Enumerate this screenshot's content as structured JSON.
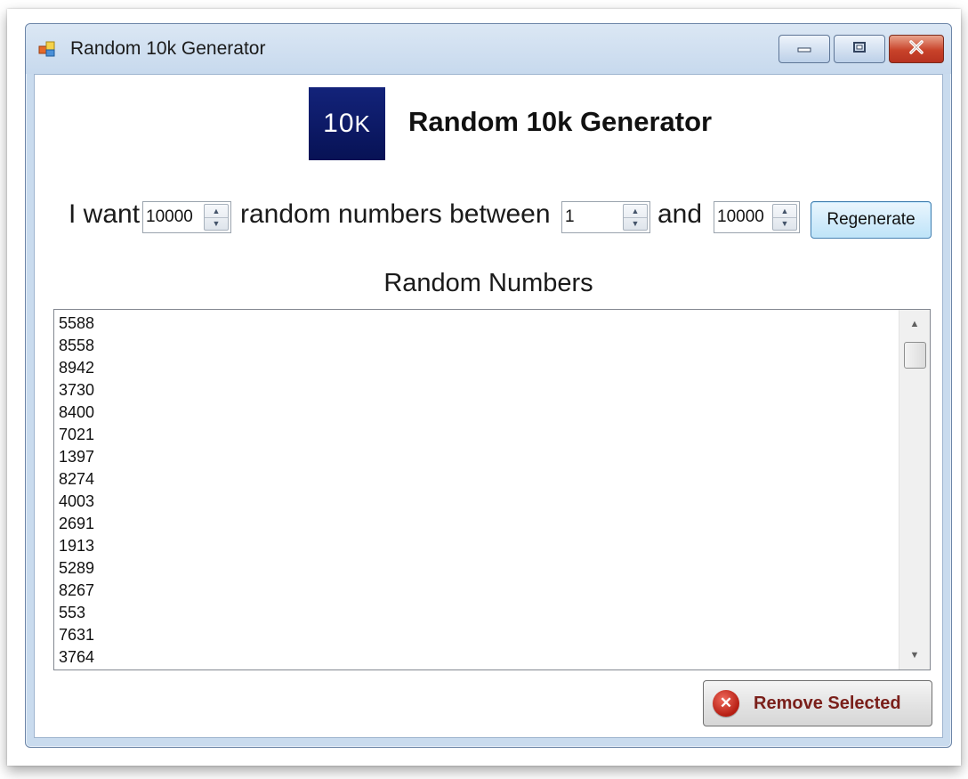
{
  "window": {
    "title": "Random 10k Generator",
    "icon": "app-window-icon",
    "controls": {
      "minimize": "minimize-icon",
      "maximize": "maximize-icon",
      "close": "close-icon"
    }
  },
  "header": {
    "logo_main": "10",
    "logo_suffix": "K",
    "title": "Random 10k Generator"
  },
  "options": {
    "prefix_text": "I want",
    "count_value": "10000",
    "middle_text": "random numbers between",
    "min_value": "1",
    "and_text": "and",
    "max_value": "10000",
    "regenerate_label": "Regenerate"
  },
  "list": {
    "label": "Random Numbers",
    "items": [
      "5588",
      "8558",
      "8942",
      "3730",
      "8400",
      "7021",
      "1397",
      "8274",
      "4003",
      "2691",
      "1913",
      "5289",
      "8267",
      "553",
      "7631",
      "3764"
    ]
  },
  "actions": {
    "remove_label": "Remove Selected",
    "remove_icon": "remove-x-icon"
  },
  "colors": {
    "logo_bg": "#0b1a66",
    "close_button": "#c8432a",
    "remove_text": "#7a1f1a"
  }
}
